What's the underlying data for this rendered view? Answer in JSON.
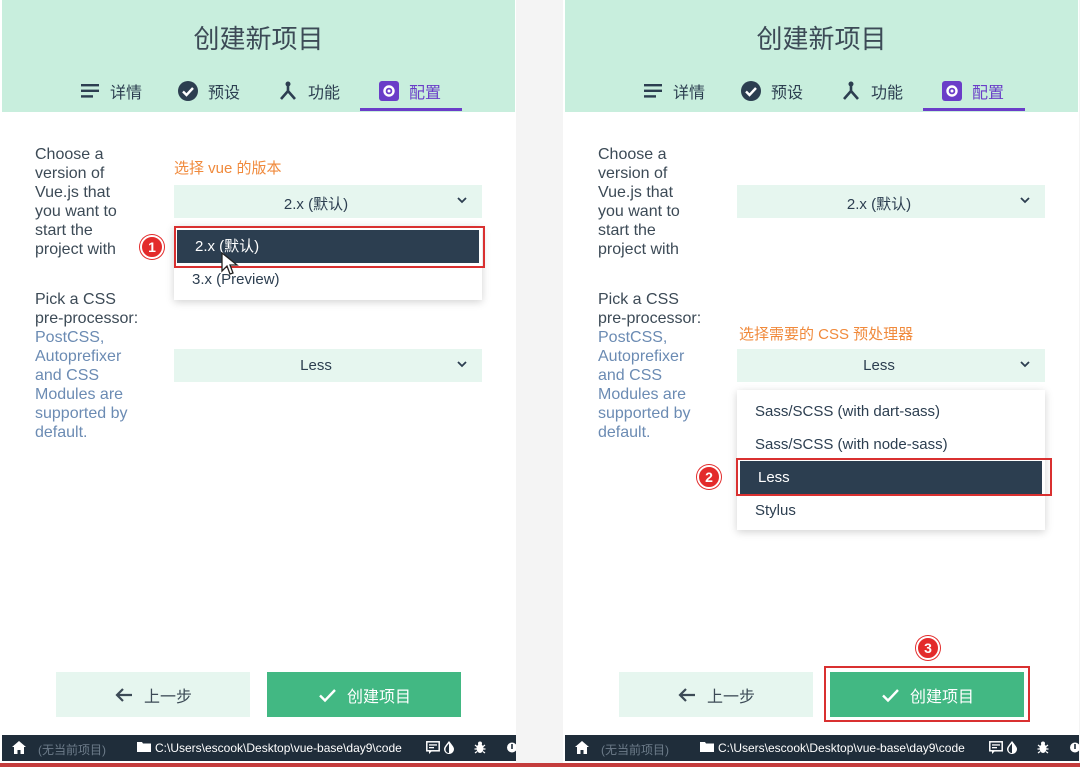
{
  "left": {
    "title": "创建新项目",
    "tabs": [
      {
        "label": "详情",
        "icon": "list-icon"
      },
      {
        "label": "预设",
        "icon": "check-circle-icon"
      },
      {
        "label": "功能",
        "icon": "fork-icon"
      },
      {
        "label": "配置",
        "icon": "settings-icon"
      }
    ],
    "version_label": "Choose a version of Vue.js that you want to start the project with",
    "version_annotation": "选择 vue 的版本",
    "version_select_value": "2.x (默认)",
    "version_options": [
      "2.x (默认)",
      "3.x (Preview)"
    ],
    "css_label": "Pick a CSS pre-processor:",
    "css_description": "PostCSS, Autoprefixer and CSS Modules are supported by default.",
    "css_select_value": "Less",
    "badge": "1",
    "prev_label": "上一步",
    "create_label": "创建项目",
    "status": {
      "home": "(无当前项目)",
      "path": "C:\\Users\\escook\\Desktop\\vue-base\\day9\\code"
    }
  },
  "right": {
    "title": "创建新项目",
    "tabs": [
      {
        "label": "详情",
        "icon": "list-icon"
      },
      {
        "label": "预设",
        "icon": "check-circle-icon"
      },
      {
        "label": "功能",
        "icon": "fork-icon"
      },
      {
        "label": "配置",
        "icon": "settings-icon"
      }
    ],
    "version_label": "Choose a version of Vue.js that you want to start the project with",
    "version_select_value": "2.x (默认)",
    "css_label": "Pick a CSS pre-processor:",
    "css_description": "PostCSS, Autoprefixer and CSS Modules are supported by default.",
    "css_annotation": "选择需要的 CSS 预处理器",
    "css_select_value": "Less",
    "css_options": [
      "Sass/SCSS (with dart-sass)",
      "Sass/SCSS (with node-sass)",
      "Less",
      "Stylus"
    ],
    "badge2": "2",
    "badge3": "3",
    "prev_label": "上一步",
    "create_label": "创建项目",
    "status": {
      "home": "(无当前项目)",
      "path": "C:\\Users\\escook\\Desktop\\vue-base\\day9\\code"
    }
  },
  "colors": {
    "header": "#c8eedd",
    "accent": "#42b883",
    "active_tab": "#6a3dc8",
    "annotation": "#f08a3c",
    "highlight": "#d93030"
  }
}
